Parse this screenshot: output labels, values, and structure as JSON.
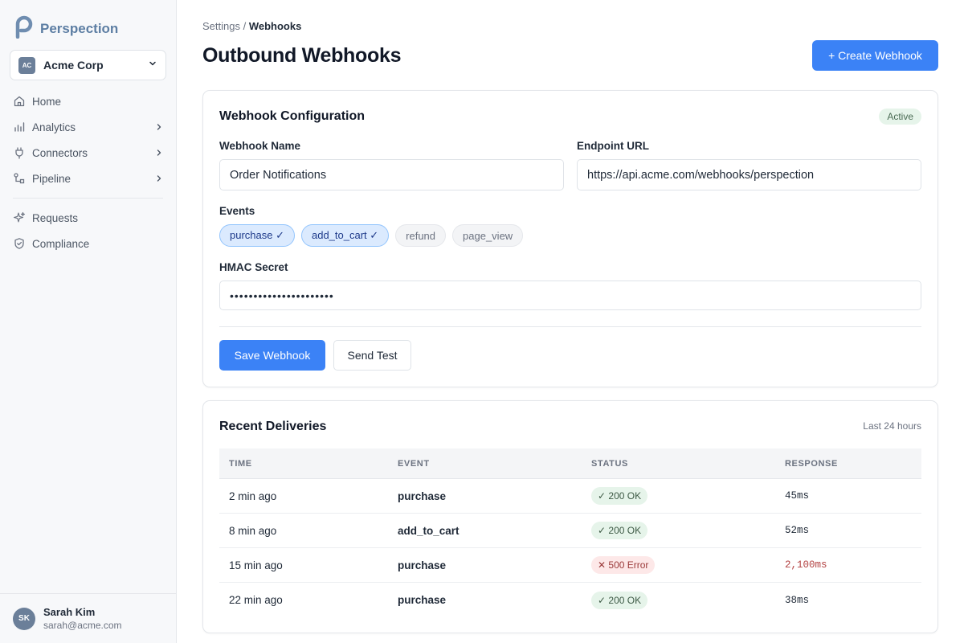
{
  "app": {
    "name": "Perspection"
  },
  "org": {
    "initials": "AC",
    "name": "Acme Corp"
  },
  "nav": {
    "primary": [
      {
        "label": "Home",
        "icon": "home-icon",
        "has_chevron": false
      },
      {
        "label": "Analytics",
        "icon": "chart-icon",
        "has_chevron": true
      },
      {
        "label": "Connectors",
        "icon": "plug-icon",
        "has_chevron": true
      },
      {
        "label": "Pipeline",
        "icon": "pipeline-icon",
        "has_chevron": true
      }
    ],
    "secondary": [
      {
        "label": "Requests",
        "icon": "sparkle-icon",
        "has_chevron": false
      },
      {
        "label": "Compliance",
        "icon": "shield-icon",
        "has_chevron": false
      }
    ]
  },
  "user": {
    "initials": "SK",
    "name": "Sarah Kim",
    "email": "sarah@acme.com"
  },
  "breadcrumb": {
    "parent": "Settings",
    "separator": " / ",
    "current": "Webhooks"
  },
  "page": {
    "title": "Outbound Webhooks",
    "create_label": "+ Create Webhook"
  },
  "config": {
    "title": "Webhook Configuration",
    "status": "Active",
    "name_label": "Webhook Name",
    "name_value": "Order Notifications",
    "url_label": "Endpoint URL",
    "url_value": "https://api.acme.com/webhooks/perspection",
    "events_label": "Events",
    "events": [
      {
        "label": "purchase ✓",
        "selected": true
      },
      {
        "label": "add_to_cart ✓",
        "selected": true
      },
      {
        "label": "refund",
        "selected": false
      },
      {
        "label": "page_view",
        "selected": false
      }
    ],
    "secret_label": "HMAC Secret",
    "secret_value": "••••••••••••••••••••••",
    "save_label": "Save Webhook",
    "test_label": "Send Test"
  },
  "deliveries": {
    "title": "Recent Deliveries",
    "range": "Last 24 hours",
    "columns": [
      "TIME",
      "EVENT",
      "STATUS",
      "RESPONSE"
    ],
    "rows": [
      {
        "time": "2 min ago",
        "event": "purchase",
        "status": "✓ 200 OK",
        "ok": true,
        "response": "45ms"
      },
      {
        "time": "8 min ago",
        "event": "add_to_cart",
        "status": "✓ 200 OK",
        "ok": true,
        "response": "52ms"
      },
      {
        "time": "15 min ago",
        "event": "purchase",
        "status": "✕ 500 Error",
        "ok": false,
        "response": "2,100ms"
      },
      {
        "time": "22 min ago",
        "event": "purchase",
        "status": "✓ 200 OK",
        "ok": true,
        "response": "38ms"
      }
    ]
  },
  "colors": {
    "accent": "#3b82f6",
    "success_bg": "#e6f4ea",
    "error_bg": "#fde8e8",
    "brand": "#5d7ea3"
  }
}
